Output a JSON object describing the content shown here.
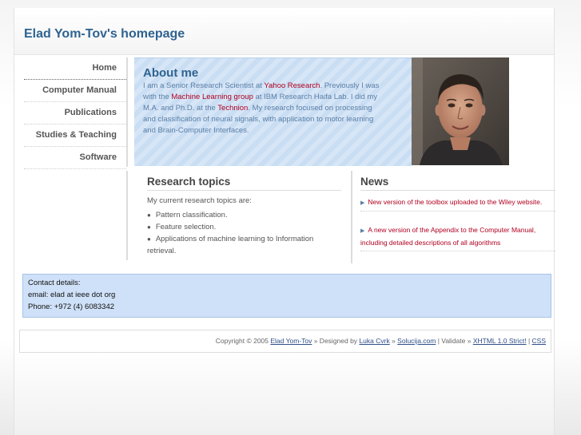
{
  "header": {
    "title": "Elad Yom-Tov's homepage"
  },
  "nav": {
    "items": [
      {
        "label": "Home"
      },
      {
        "label": "Computer Manual"
      },
      {
        "label": "Publications"
      },
      {
        "label": "Studies & Teaching"
      },
      {
        "label": "Software"
      }
    ]
  },
  "about": {
    "heading": "About me",
    "text_1": "I am a Senior Research Scientist at ",
    "link_yahoo": "Yahoo Research",
    "text_2": ". Previously I was with the ",
    "link_ml_group": "Machine Learning group",
    "text_3": " at IBM Research Haifa Lab. I did my M.A. and Ph.D. at the ",
    "link_technion": "Technion",
    "text_4": ". My research focused on processing and classification of neural signals, with application to motor learning and Brain-Computer Interfaces."
  },
  "research": {
    "heading": "Research topics",
    "intro": "My current research topics are:",
    "topics": [
      "Pattern classification.",
      "Feature selection.",
      "Applications of machine learning to Information retrieval."
    ]
  },
  "news": {
    "heading": "News",
    "items": [
      {
        "text": "New version of the toolbox uploaded to the Wiley website."
      },
      {
        "text": "A new version of the Appendix to the Computer Manual, including detailed descriptions of all algorithms"
      }
    ]
  },
  "contact": {
    "title": "Contact details:",
    "email": "email: elad at ieee dot org",
    "phone": "Phone: +972 (4) 6083342"
  },
  "footer": {
    "copyright": "Copyright © 2005 ",
    "author_link": "Elad Yom-Tov",
    "designed_by": " » Designed by ",
    "designer_link": "Luka Cvrk",
    "sep1": " » ",
    "solucija_link": "Solucija.com",
    "validate": " | Validate » ",
    "xhtml_link": "XHTML 1.0 Strict!",
    "sep2": " | ",
    "css_link": "CSS"
  },
  "colors": {
    "title_blue": "#2e6390",
    "link_red": "#b00020",
    "contact_bg": "#cfe1f8"
  }
}
